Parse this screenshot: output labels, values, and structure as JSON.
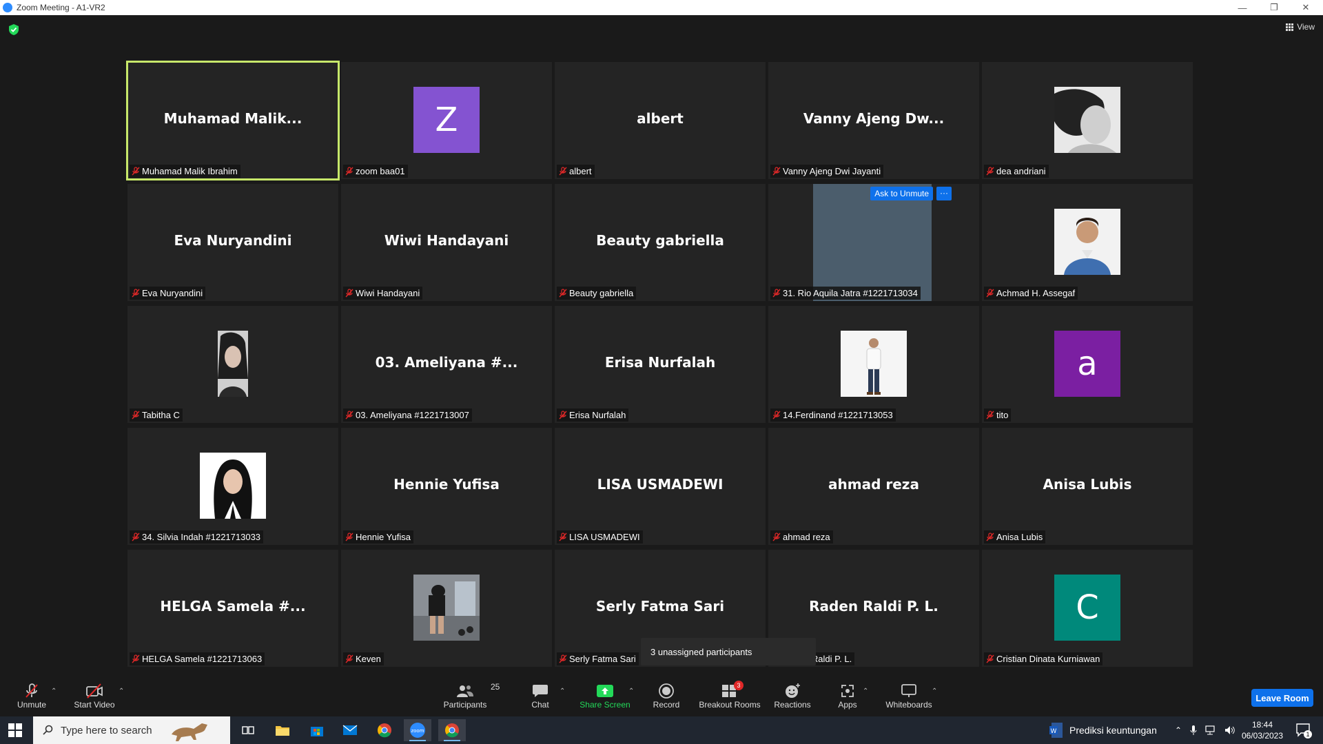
{
  "window": {
    "title": "Zoom Meeting - A1-VR2"
  },
  "header": {
    "view_label": "View"
  },
  "tiles": [
    {
      "big": "Muhamad  Malik...",
      "label": "Muhamad Malik Ibrahim",
      "type": "name",
      "active": true
    },
    {
      "big": "Z",
      "label": "zoom baa01",
      "type": "avatar",
      "color": "#8453d1"
    },
    {
      "big": "albert",
      "label": "albert",
      "type": "name"
    },
    {
      "big": "Vanny  Ajeng  Dw...",
      "label": "Vanny Ajeng Dwi Jayanti",
      "type": "name"
    },
    {
      "big": "",
      "label": "dea andriani",
      "type": "photo",
      "photo": "girl-bw"
    },
    {
      "big": "Eva Nuryandini",
      "label": "Eva Nuryandini",
      "type": "name"
    },
    {
      "big": "Wiwi Handayani",
      "label": "Wiwi Handayani",
      "type": "name"
    },
    {
      "big": "Beauty gabriella",
      "label": "Beauty gabriella",
      "type": "name"
    },
    {
      "big": "",
      "label": "31. Rio Aquila Jatra #1221713034",
      "type": "video",
      "ask": "Ask to Unmute",
      "more": "···"
    },
    {
      "big": "",
      "label": "Achmad H. Assegaf",
      "type": "photo",
      "photo": "man-shirt"
    },
    {
      "big": "",
      "label": "Tabitha C",
      "type": "photo",
      "photo": "girl-portrait"
    },
    {
      "big": "03.  Ameliyana  #...",
      "label": "03. Ameliyana #1221713007",
      "type": "name"
    },
    {
      "big": "Erisa Nurfalah",
      "label": "Erisa Nurfalah",
      "type": "name"
    },
    {
      "big": "",
      "label": "14.Ferdinand #1221713053",
      "type": "photo",
      "photo": "man-standing"
    },
    {
      "big": "a",
      "label": "tito",
      "type": "avatar",
      "color": "#7b1fa2"
    },
    {
      "big": "",
      "label": "34. Silvia Indah #1221713033",
      "type": "photo",
      "photo": "hijab"
    },
    {
      "big": "Hennie Yufisa",
      "label": "Hennie Yufisa",
      "type": "name"
    },
    {
      "big": "LISA USMADEWI",
      "label": "LISA USMADEWI",
      "type": "name"
    },
    {
      "big": "ahmad reza",
      "label": "ahmad reza",
      "type": "name"
    },
    {
      "big": "Anisa Lubis",
      "label": "Anisa Lubis",
      "type": "name"
    },
    {
      "big": "HELGA  Samela  #...",
      "label": "HELGA Samela #1221713063",
      "type": "name"
    },
    {
      "big": "",
      "label": "Keven",
      "type": "photo",
      "photo": "gym"
    },
    {
      "big": "Serly Fatma Sari",
      "label": "Serly Fatma Sari",
      "type": "name"
    },
    {
      "big": "Raden Raldi P. L.",
      "label": "Raden Raldi P. L.",
      "type": "name"
    },
    {
      "big": "C",
      "label": "Cristian Dinata Kurniawan",
      "type": "avatar",
      "color": "#00897b"
    }
  ],
  "tooltip": {
    "text": "3 unassigned participants"
  },
  "toolbar": {
    "unmute": "Unmute",
    "start_video": "Start Video",
    "participants": "Participants",
    "participants_count": "25",
    "chat": "Chat",
    "share_screen": "Share Screen",
    "record": "Record",
    "breakout_rooms": "Breakout Rooms",
    "breakout_badge": "3",
    "reactions": "Reactions",
    "apps": "Apps",
    "whiteboards": "Whiteboards",
    "leave": "Leave Room"
  },
  "taskbar": {
    "search_placeholder": "Type here to search",
    "notification": "Prediksi keuntungan",
    "time": "18:44",
    "date": "06/03/2023",
    "notif_count": "1"
  },
  "colors": {
    "accent": "#0e71eb",
    "active_speaker": "#c7e86a",
    "share_green": "#23d959",
    "muted_red": "#e02828"
  }
}
